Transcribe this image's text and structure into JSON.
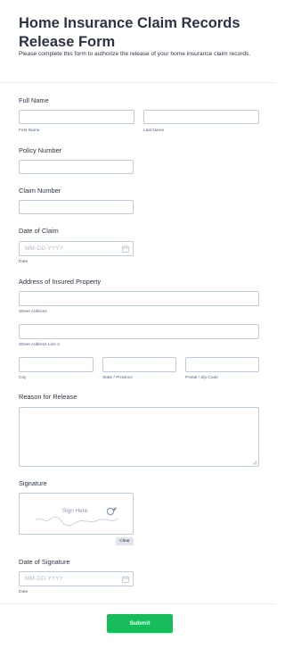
{
  "form": {
    "title": "Home Insurance Claim Records Release Form",
    "subtitle": "Please complete this form to authorize the release of your home insurance claim records."
  },
  "full_name": {
    "label": "Full Name",
    "first_sublabel": "First Name",
    "last_sublabel": "Last Name",
    "first_value": "",
    "last_value": ""
  },
  "policy_number": {
    "label": "Policy Number",
    "value": ""
  },
  "claim_number": {
    "label": "Claim Number",
    "value": ""
  },
  "date_of_claim": {
    "label": "Date of Claim",
    "placeholder": "MM-DD-YYYY",
    "sublabel": "Date",
    "icon": "calendar-icon"
  },
  "address": {
    "label": "Address of Insured Property",
    "street_sublabel": "Street Address",
    "street2_sublabel": "Street Address Line 2",
    "city_sublabel": "City",
    "state_sublabel": "State / Province",
    "postal_sublabel": "Postal / Zip Code"
  },
  "reason": {
    "label": "Reason for Release",
    "value": "",
    "icon": "resize-handle-icon"
  },
  "signature": {
    "label": "Signature",
    "placeholder": "Sign Here",
    "clear_label": "Clear"
  },
  "date_of_signature": {
    "label": "Date of Signature",
    "placeholder": "MM-DD-YYYY",
    "sublabel": "Date",
    "icon": "calendar-icon"
  },
  "submit": {
    "label": "Submit",
    "color": "#18bd5b"
  },
  "colors": {
    "text": "#2c3345",
    "border": "#c3cad8",
    "sublabel": "#57647e",
    "placeholder": "#b5b9c6",
    "clear_bg": "#e3e5ec"
  }
}
